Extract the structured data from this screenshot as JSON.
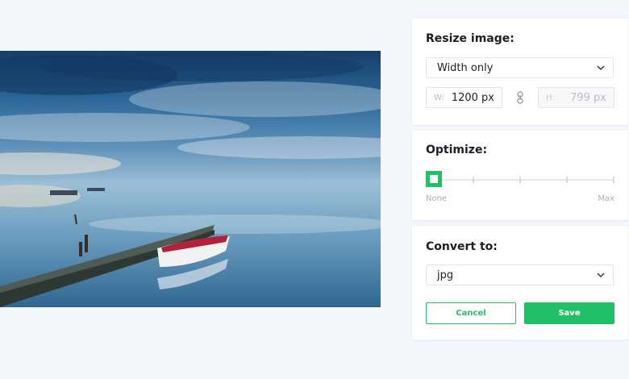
{
  "photo": {
    "description_icon": "landscape-photo"
  },
  "resize": {
    "title": "Resize image:",
    "mode": "Width only",
    "width_label": "W:",
    "width_value": "1200 px",
    "height_label": "H:",
    "height_value": "799 px"
  },
  "optimize": {
    "title": "Optimize:",
    "level": 0,
    "min_label": "None",
    "max_label": "Max"
  },
  "convert": {
    "title": "Convert to:",
    "format": "jpg",
    "cancel_label": "Cancel",
    "save_label": "Save"
  },
  "colors": {
    "accent": "#20c067",
    "background": "#f3f6fb"
  }
}
